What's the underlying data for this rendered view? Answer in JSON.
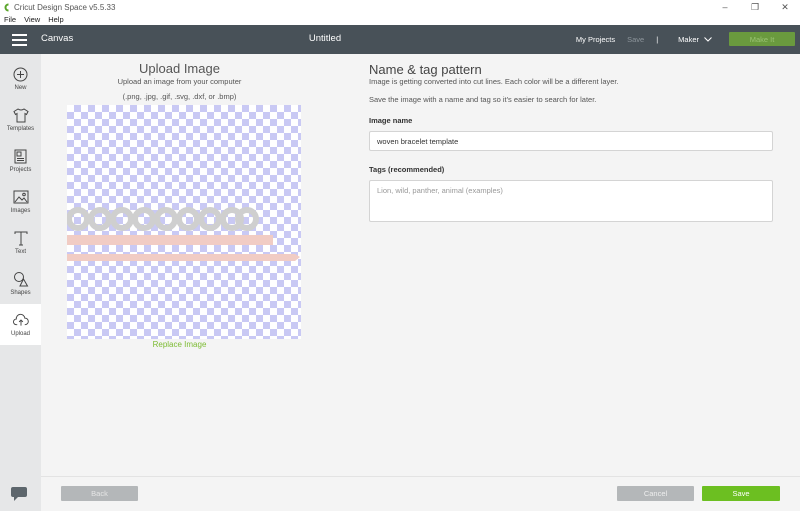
{
  "window": {
    "title": "Cricut Design Space  v5.5.33",
    "controls": [
      "–",
      "❐",
      "✕"
    ]
  },
  "menu": [
    "File",
    "View",
    "Help"
  ],
  "header": {
    "section": "Canvas",
    "title": "Untitled",
    "my_projects": "My Projects",
    "save": "Save",
    "separator": "|",
    "machine": "Maker",
    "make_it": "Make It"
  },
  "sidebar": {
    "items": [
      {
        "label": "New",
        "icon": "plus-circle-icon"
      },
      {
        "label": "Templates",
        "icon": "tshirt-icon"
      },
      {
        "label": "Projects",
        "icon": "projects-icon"
      },
      {
        "label": "Images",
        "icon": "image-icon"
      },
      {
        "label": "Text",
        "icon": "text-icon"
      },
      {
        "label": "Shapes",
        "icon": "shapes-icon"
      },
      {
        "label": "Upload",
        "icon": "cloud-upload-icon"
      }
    ],
    "active": "Upload"
  },
  "upload": {
    "title": "Upload Image",
    "subtitle": "Upload an image from your computer",
    "formats": "(.png, .jpg, .gif, .svg, .dxf, or .bmp)",
    "replace": "Replace Image"
  },
  "tag_form": {
    "title": "Name & tag pattern",
    "info1": "Image is getting converted into cut lines. Each color will be a different layer.",
    "info2": "Save the image with a name and tag so it's easier to search for later.",
    "name_label": "Image name",
    "name_value": "woven bracelet template",
    "tags_label": "Tags (recommended)",
    "tags_placeholder": "Lion, wild, panther, animal (examples)"
  },
  "footer": {
    "back": "Back",
    "cancel": "Cancel",
    "save": "Save"
  },
  "colors": {
    "header_bg": "#485158",
    "accent_green": "#6cbf21",
    "sidebar_bg": "#e6e7e8",
    "checker": "#c9c9f4",
    "ring_gray": "#cfcfcf",
    "band_pink": "#f1ccc4"
  }
}
